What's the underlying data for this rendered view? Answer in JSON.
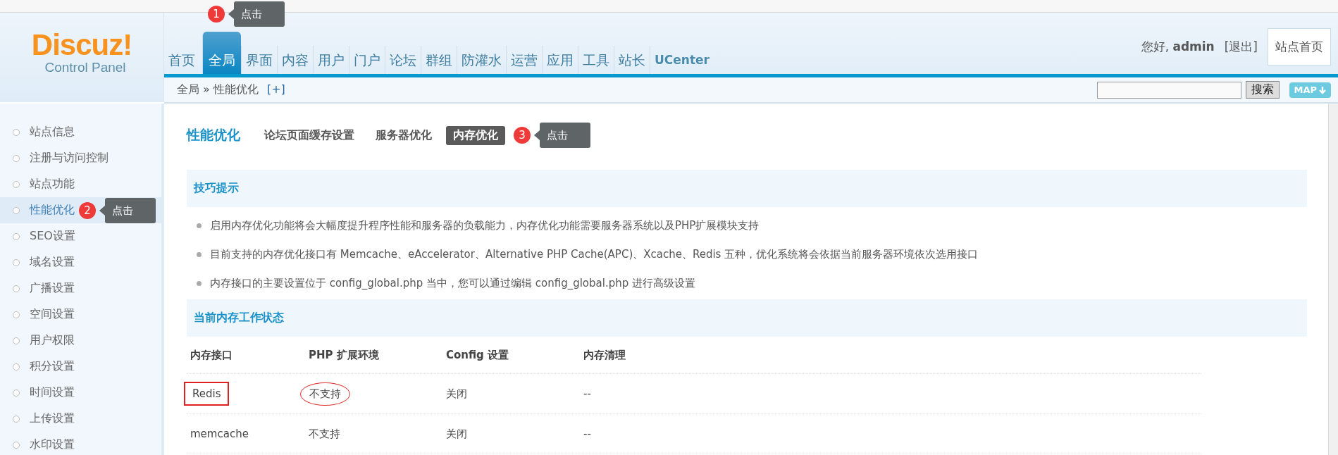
{
  "logo": {
    "title": "Discuz!",
    "subtitle": "Control Panel"
  },
  "nav": [
    {
      "label": "首页",
      "selected": false
    },
    {
      "label": "全局",
      "selected": true,
      "callout": {
        "number": "1",
        "text": "点击"
      }
    },
    {
      "label": "界面",
      "selected": false
    },
    {
      "label": "内容",
      "selected": false
    },
    {
      "label": "用户",
      "selected": false
    },
    {
      "label": "门户",
      "selected": false
    },
    {
      "label": "论坛",
      "selected": false
    },
    {
      "label": "群组",
      "selected": false
    },
    {
      "label": "防灌水",
      "selected": false
    },
    {
      "label": "运营",
      "selected": false
    },
    {
      "label": "应用",
      "selected": false
    },
    {
      "label": "工具",
      "selected": false
    },
    {
      "label": "站长",
      "selected": false
    },
    {
      "label": "UCenter",
      "selected": false,
      "kind": "brand"
    }
  ],
  "user": {
    "greeting": "您好,",
    "name": "admin",
    "logout": "[退出]",
    "home_button": "站点首页"
  },
  "breadcrumb": {
    "path": "全局 » 性能优化",
    "add": "[+]"
  },
  "search": {
    "button": "搜索",
    "map": "MAP"
  },
  "sidebar": [
    {
      "label": "站点信息",
      "selected": false
    },
    {
      "label": "注册与访问控制",
      "selected": false
    },
    {
      "label": "站点功能",
      "selected": false
    },
    {
      "label": "性能优化",
      "selected": true,
      "callout": {
        "number": "2",
        "text": "点击"
      }
    },
    {
      "label": "SEO设置",
      "selected": false
    },
    {
      "label": "域名设置",
      "selected": false
    },
    {
      "label": "广播设置",
      "selected": false
    },
    {
      "label": "空间设置",
      "selected": false
    },
    {
      "label": "用户权限",
      "selected": false
    },
    {
      "label": "积分设置",
      "selected": false
    },
    {
      "label": "时间设置",
      "selected": false
    },
    {
      "label": "上传设置",
      "selected": false
    },
    {
      "label": "水印设置",
      "selected": false
    }
  ],
  "page": {
    "title": "性能优化",
    "tabs": [
      {
        "label": "论坛页面缓存设置",
        "selected": false
      },
      {
        "label": "服务器优化",
        "selected": false
      },
      {
        "label": "内存优化",
        "selected": true,
        "callout": {
          "number": "3",
          "text": "点击"
        }
      }
    ]
  },
  "tips": {
    "title": "技巧提示",
    "items": [
      "启用内存优化功能将会大幅度提升程序性能和服务器的负载能力，内存优化功能需要服务器系统以及PHP扩展模块支持",
      "目前支持的内存优化接口有 Memcache、eAccelerator、Alternative PHP Cache(APC)、Xcache、Redis 五种，优化系统将会依据当前服务器环境依次选用接口",
      "内存接口的主要设置位于 config_global.php 当中，您可以通过编辑 config_global.php 进行高级设置"
    ]
  },
  "status": {
    "title": "当前内存工作状态",
    "columns": [
      "内存接口",
      "PHP 扩展环境",
      "Config 设置",
      "内存清理"
    ],
    "rows": [
      [
        {
          "text": "Redis",
          "boxed": true,
          "circled": false
        },
        {
          "text": "不支持",
          "boxed": false,
          "circled": true
        },
        {
          "text": "关闭",
          "boxed": false,
          "circled": false
        },
        {
          "text": "--",
          "boxed": false,
          "circled": false
        }
      ],
      [
        {
          "text": "memcache",
          "boxed": false,
          "circled": false
        },
        {
          "text": "不支持",
          "boxed": false,
          "circled": false
        },
        {
          "text": "关闭",
          "boxed": false,
          "circled": false
        },
        {
          "text": "--",
          "boxed": false,
          "circled": false
        }
      ]
    ]
  }
}
